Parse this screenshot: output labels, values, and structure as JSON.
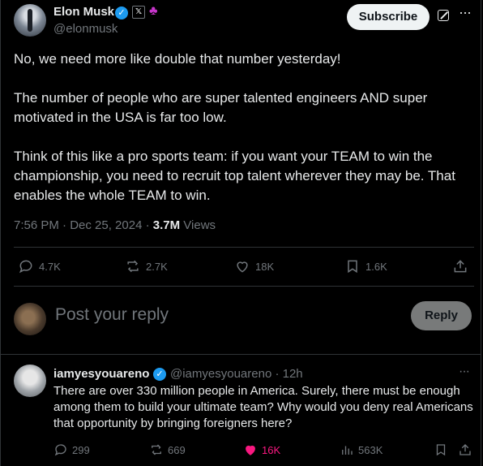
{
  "author": {
    "name": "Elon Musk",
    "handle": "@elonmusk",
    "verified_icon": "verified-badge-icon",
    "x_badge": "𝕏",
    "affiliate_icon": "affiliate-badge-icon"
  },
  "header": {
    "subscribe_label": "Subscribe",
    "grok_icon": "grok-icon",
    "more_icon": "more-icon",
    "more_glyph": "···"
  },
  "tweet": {
    "paragraphs": [
      "No, we need more like double that number yesterday!",
      "The number of people who are super talented engineers AND super motivated in the USA is far too low.",
      "Think of this like a pro sports team: if you want your TEAM to win the championship, you need to recruit top talent wherever they may be. That enables the whole TEAM to win."
    ],
    "time": "7:56 PM · Dec 25, 2024 · ",
    "views_count": "3.7M",
    "views_label": " Views"
  },
  "actions": {
    "replies": "4.7K",
    "reposts": "2.7K",
    "likes": "18K",
    "bookmarks": "1.6K"
  },
  "compose": {
    "placeholder": "Post your reply",
    "reply_label": "Reply"
  },
  "comment": {
    "name": "iamyesyouareno",
    "handle": "@iamyesyouareno · 12h",
    "more_glyph": "···",
    "text": "There are over 330 million people in America. Surely, there must be enough among them to build your ultimate team? Why would you deny real Americans that opportunity by bringing foreigners here?",
    "replies": "299",
    "reposts": "669",
    "likes": "16K",
    "views": "563K"
  },
  "colors": {
    "background": "#000000",
    "text": "#e7e9ea",
    "muted": "#71767b",
    "verified": "#1d9bf0",
    "like": "#f91880"
  }
}
